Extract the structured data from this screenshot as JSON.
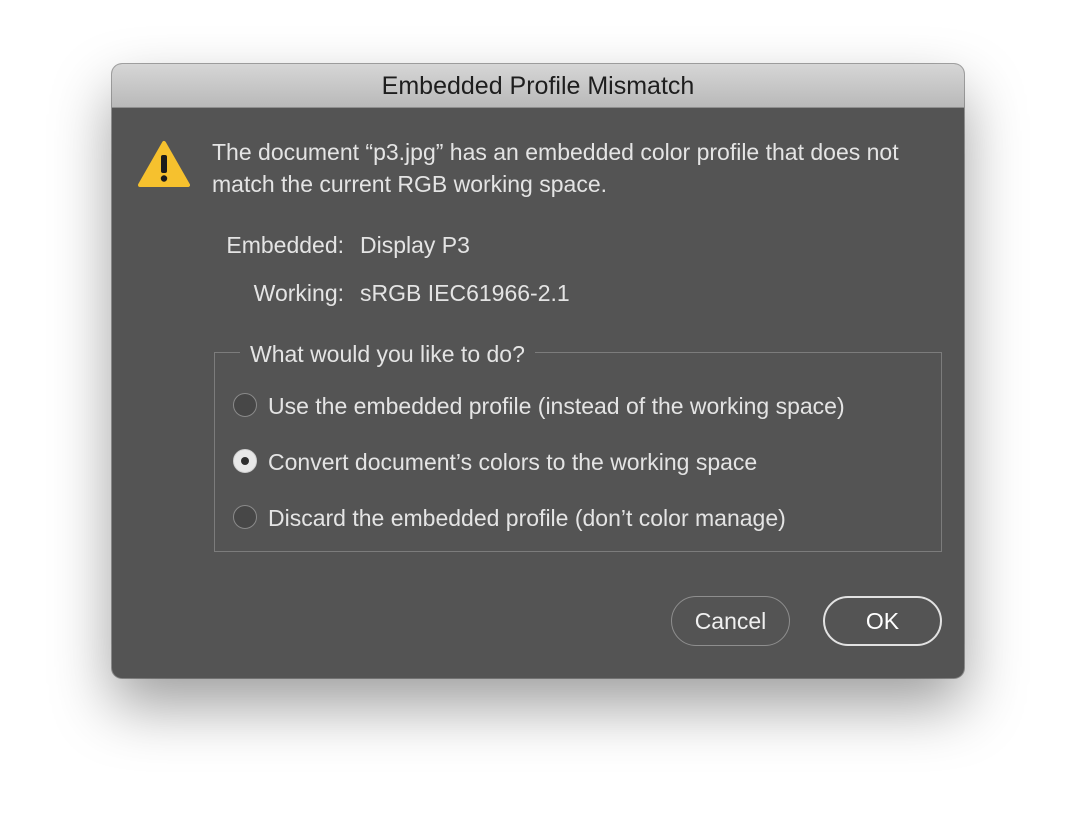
{
  "dialog": {
    "title": "Embedded Profile Mismatch",
    "icon": "warning-icon",
    "message": "The document “p3.jpg” has an embedded color profile that does not match the current RGB working space.",
    "embedded": {
      "label": "Embedded:",
      "value": "Display P3"
    },
    "working": {
      "label": "Working:",
      "value": "sRGB IEC61966-2.1"
    },
    "group_title": "What would you like to do?",
    "options": [
      {
        "label": "Use the embedded profile (instead of the working space)",
        "checked": false
      },
      {
        "label": "Convert document’s colors to the working space",
        "checked": true
      },
      {
        "label": "Discard the embedded profile (don’t color manage)",
        "checked": false
      }
    ],
    "buttons": {
      "cancel": "Cancel",
      "ok": "OK"
    }
  },
  "colors": {
    "dialog_bg": "#545454",
    "titlebar_bg": "#c8c8c8",
    "text": "#e4e4e4",
    "warning_yellow": "#f6c12e"
  }
}
